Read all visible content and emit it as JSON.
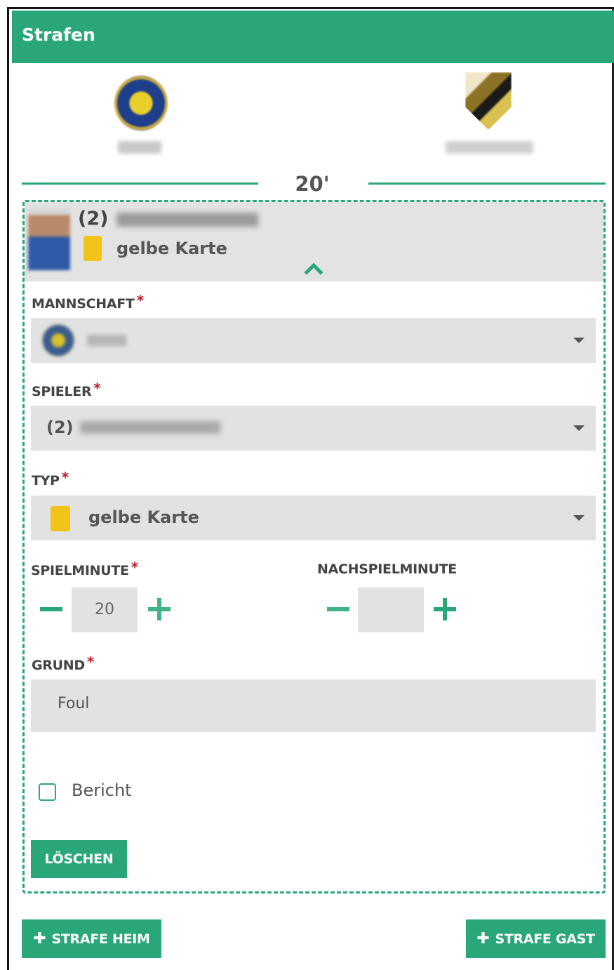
{
  "header": {
    "title": "Strafen"
  },
  "teams": {
    "home": {
      "name": "████",
      "crest_icon": "team-crest-home"
    },
    "away": {
      "name": "████████",
      "crest_icon": "team-crest-away"
    }
  },
  "minute_divider": {
    "label": "20'"
  },
  "penalty_summary": {
    "player_number": "(2)",
    "player_name": "████████, ████",
    "type_label": "gelbe Karte",
    "card_color": "#f2c418"
  },
  "form": {
    "team_label": "MANNSCHAFT",
    "team_value": "████",
    "player_label": "SPIELER",
    "player_number": "(2)",
    "player_value": "████████, ████",
    "type_label": "TYP",
    "type_value": "gelbe Karte",
    "minute_label": "SPIELMINUTE",
    "minute_value": "20",
    "extra_minute_label": "NACHSPIELMINUTE",
    "extra_minute_value": "",
    "reason_label": "GRUND",
    "reason_value": "Foul",
    "report_label": "Bericht",
    "required_marker": "*",
    "delete_label": "LÖSCHEN"
  },
  "actions": {
    "add_home_label": "STRAFE HEIM",
    "add_away_label": "STRAFE GAST",
    "plus_glyph": "✚"
  },
  "colors": {
    "accent": "#2aa778",
    "required": "#c0182a",
    "field_bg": "#e2e2e2",
    "yellow_card": "#f2c418"
  }
}
